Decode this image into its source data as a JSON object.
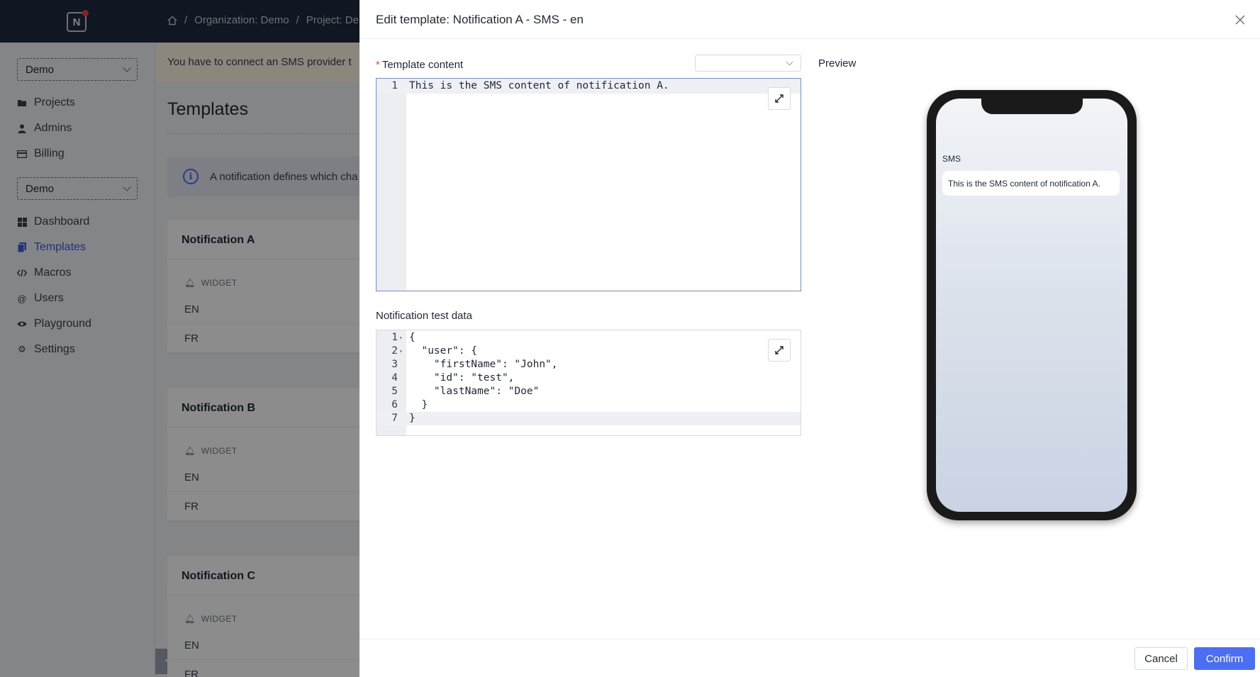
{
  "header": {
    "breadcrumb": [
      "Organization: Demo",
      "Project: Dem"
    ],
    "separator": "/"
  },
  "sidebar": {
    "org_select": "Demo",
    "project_select": "Demo",
    "org_items": [
      {
        "label": "Projects",
        "icon": "folder-icon"
      },
      {
        "label": "Admins",
        "icon": "user-icon"
      },
      {
        "label": "Billing",
        "icon": "billing-icon"
      }
    ],
    "project_items": [
      {
        "label": "Dashboard",
        "icon": "dashboard-icon"
      },
      {
        "label": "Templates",
        "icon": "templates-icon",
        "active": true
      },
      {
        "label": "Macros",
        "icon": "code-icon"
      },
      {
        "label": "Users",
        "icon": "at-icon"
      },
      {
        "label": "Playground",
        "icon": "eye-icon"
      },
      {
        "label": "Settings",
        "icon": "gear-icon"
      }
    ],
    "collapse_glyph": "<"
  },
  "main": {
    "warning": "You have to connect an SMS provider t",
    "title": "Templates",
    "info": "A notification defines which cha",
    "cards": [
      {
        "title": "Notification A",
        "widget": "WIDGET",
        "langs": [
          "EN",
          "FR"
        ]
      },
      {
        "title": "Notification B",
        "widget": "WIDGET",
        "langs": [
          "EN",
          "FR"
        ]
      },
      {
        "title": "Notification C",
        "widget": "WIDGET",
        "langs": [
          "EN",
          "FR"
        ]
      }
    ]
  },
  "drawer": {
    "title": "Edit template: Notification A - SMS - en",
    "template_content_label": "Template content",
    "template_lines": [
      "This is the SMS content of notification A."
    ],
    "test_data_label": "Notification test data",
    "test_data_lines": [
      "{",
      "  \"user\": {",
      "    \"firstName\": \"John\",",
      "    \"id\": \"test\",",
      "    \"lastName\": \"Doe\"",
      "  }",
      "}"
    ],
    "preview_label": "Preview",
    "preview": {
      "channel": "SMS",
      "message": "This is the SMS content of notification A."
    },
    "cancel_label": "Cancel",
    "confirm_label": "Confirm"
  },
  "colors": {
    "accent": "#4c6ef5",
    "header_bg": "#1e2a3e",
    "warning_bg": "#fdf6e3",
    "required": "#ef4444"
  }
}
